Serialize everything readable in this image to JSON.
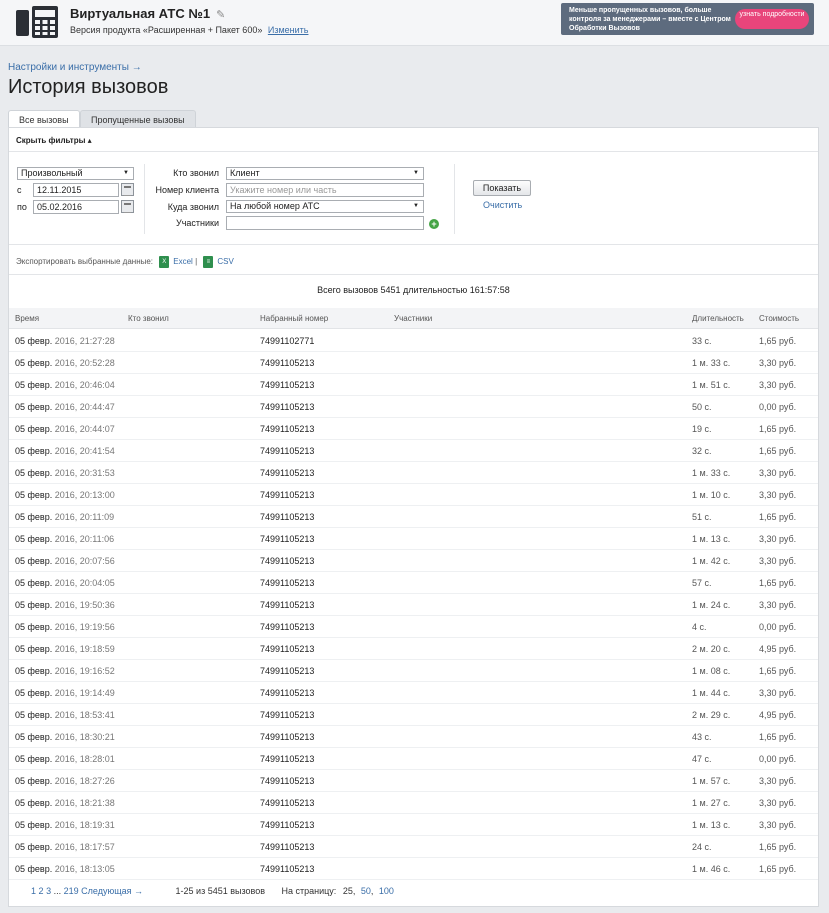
{
  "header": {
    "title": "Виртуальная АТС №1",
    "version": "Версия продукта «Расширенная + Пакет 600»",
    "change_link": "Изменить",
    "promo": {
      "text": "Меньше пропущенных вызовов, больше контроля за менеджерами – вместе с Центром Обработки Вызовов",
      "button": "узнать подробности",
      "color": "#5d6b7e",
      "button_color": "#e8457b"
    }
  },
  "breadcrumb": "Настройки и инструменты →",
  "page_title": "История вызовов",
  "tabs": [
    {
      "label": "Все вызовы",
      "active": true
    },
    {
      "label": "Пропущенные вызовы",
      "active": false
    }
  ],
  "filters": {
    "toggle_label": "Скрыть фильтры",
    "period": "Произвольный",
    "from_label": "с",
    "from": "12.11.2015",
    "to_label": "по",
    "to": "05.02.2016",
    "caller_label": "Кто звонил",
    "caller_value": "Клиент",
    "client_number_label": "Номер клиента",
    "client_number_placeholder": "Укажите номер или часть",
    "called_label": "Куда звонил",
    "called_value": "На любой номер АТС",
    "participants_label": "Участники",
    "participants_value": "",
    "show_button": "Показать",
    "clear_link": "Очистить"
  },
  "export": {
    "label": "Экспортировать выбранные данные:",
    "excel": "Excel",
    "separator": "|",
    "csv": "CSV"
  },
  "summary": "Всего вызовов 5451 длительностью 161:57:58",
  "table": {
    "columns": [
      "Время",
      "Кто звонил",
      "Набранный номер",
      "Участники",
      "Длительность",
      "Стоимость"
    ],
    "rows": [
      {
        "day": "05 февр.",
        "year": "2016, 21:27:",
        "sec": "28",
        "number": "74991102771",
        "duration": "33 с.",
        "cost": "1,65 руб."
      },
      {
        "day": "05 февр.",
        "year": "2016, 20:52:",
        "sec": "28",
        "number": "74991105213",
        "duration": "1 м. 33 с.",
        "cost": "3,30 руб."
      },
      {
        "day": "05 февр.",
        "year": "2016, 20:46:",
        "sec": "04",
        "number": "74991105213",
        "duration": "1 м. 51 с.",
        "cost": "3,30 руб."
      },
      {
        "day": "05 февр.",
        "year": "2016, 20:44:",
        "sec": "47",
        "number": "74991105213",
        "duration": "50 с.",
        "cost": "0,00 руб."
      },
      {
        "day": "05 февр.",
        "year": "2016, 20:44:",
        "sec": "07",
        "number": "74991105213",
        "duration": "19 с.",
        "cost": "1,65 руб."
      },
      {
        "day": "05 февр.",
        "year": "2016, 20:41:",
        "sec": "54",
        "number": "74991105213",
        "duration": "32 с.",
        "cost": "1,65 руб."
      },
      {
        "day": "05 февр.",
        "year": "2016, 20:31:",
        "sec": "53",
        "number": "74991105213",
        "duration": "1 м. 33 с.",
        "cost": "3,30 руб."
      },
      {
        "day": "05 февр.",
        "year": "2016, 20:13:",
        "sec": "00",
        "number": "74991105213",
        "duration": "1 м. 10 с.",
        "cost": "3,30 руб."
      },
      {
        "day": "05 февр.",
        "year": "2016, 20:11:",
        "sec": "09",
        "number": "74991105213",
        "duration": "51 с.",
        "cost": "1,65 руб."
      },
      {
        "day": "05 февр.",
        "year": "2016, 20:11:",
        "sec": "06",
        "number": "74991105213",
        "duration": "1 м. 13 с.",
        "cost": "3,30 руб."
      },
      {
        "day": "05 февр.",
        "year": "2016, 20:07:",
        "sec": "56",
        "number": "74991105213",
        "duration": "1 м. 42 с.",
        "cost": "3,30 руб."
      },
      {
        "day": "05 февр.",
        "year": "2016, 20:04:",
        "sec": "05",
        "number": "74991105213",
        "duration": "57 с.",
        "cost": "1,65 руб."
      },
      {
        "day": "05 февр.",
        "year": "2016, 19:50:",
        "sec": "36",
        "number": "74991105213",
        "duration": "1 м. 24 с.",
        "cost": "3,30 руб."
      },
      {
        "day": "05 февр.",
        "year": "2016, 19:19:",
        "sec": "56",
        "number": "74991105213",
        "duration": "4 с.",
        "cost": "0,00 руб."
      },
      {
        "day": "05 февр.",
        "year": "2016, 19:18:",
        "sec": "59",
        "number": "74991105213",
        "duration": "2 м. 20 с.",
        "cost": "4,95 руб."
      },
      {
        "day": "05 февр.",
        "year": "2016, 19:16:",
        "sec": "52",
        "number": "74991105213",
        "duration": "1 м. 08 с.",
        "cost": "1,65 руб."
      },
      {
        "day": "05 февр.",
        "year": "2016, 19:14:",
        "sec": "49",
        "number": "74991105213",
        "duration": "1 м. 44 с.",
        "cost": "3,30 руб."
      },
      {
        "day": "05 февр.",
        "year": "2016, 18:53:",
        "sec": "41",
        "number": "74991105213",
        "duration": "2 м. 29 с.",
        "cost": "4,95 руб."
      },
      {
        "day": "05 февр.",
        "year": "2016, 18:30:",
        "sec": "21",
        "number": "74991105213",
        "duration": "43 с.",
        "cost": "1,65 руб."
      },
      {
        "day": "05 февр.",
        "year": "2016, 18:28:",
        "sec": "01",
        "number": "74991105213",
        "duration": "47 с.",
        "cost": "0,00 руб."
      },
      {
        "day": "05 февр.",
        "year": "2016, 18:27:",
        "sec": "26",
        "number": "74991105213",
        "duration": "1 м. 57 с.",
        "cost": "3,30 руб."
      },
      {
        "day": "05 февр.",
        "year": "2016, 18:21:",
        "sec": "38",
        "number": "74991105213",
        "duration": "1 м. 27 с.",
        "cost": "3,30 руб."
      },
      {
        "day": "05 февр.",
        "year": "2016, 18:19:",
        "sec": "31",
        "number": "74991105213",
        "duration": "1 м. 13 с.",
        "cost": "3,30 руб."
      },
      {
        "day": "05 февр.",
        "year": "2016, 18:17:",
        "sec": "57",
        "number": "74991105213",
        "duration": "24 с.",
        "cost": "1,65 руб."
      },
      {
        "day": "05 февр.",
        "year": "2016, 18:13:",
        "sec": "05",
        "number": "74991105213",
        "duration": "1 м. 46 с.",
        "cost": "1,65 руб."
      }
    ]
  },
  "pagination": {
    "pages": [
      "1",
      "2",
      "3"
    ],
    "ellipsis": "...",
    "last_page": "219",
    "next": "Следующая →",
    "range": "1-25 из 5451 вызовов",
    "per_page_label": "На страницу:",
    "per_page_options": [
      "25",
      "50",
      "100"
    ]
  }
}
